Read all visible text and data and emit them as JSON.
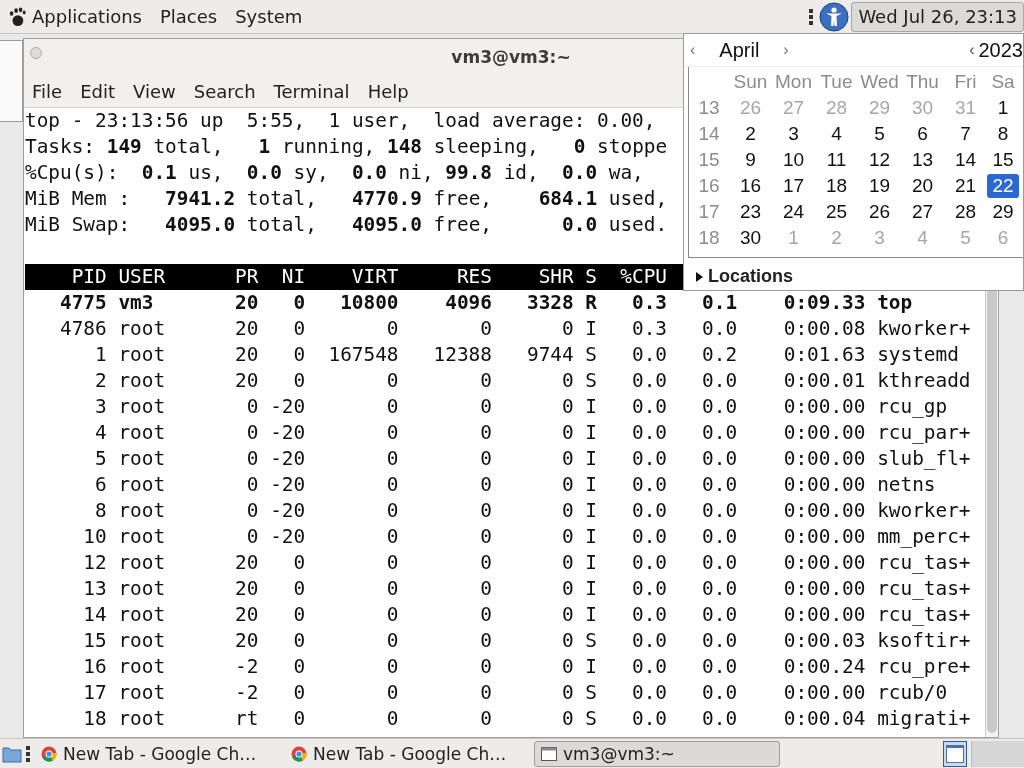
{
  "top_panel": {
    "menus": [
      "Applications",
      "Places",
      "System"
    ],
    "clock": "Wed Jul 26, 23:13"
  },
  "terminal": {
    "title": "vm3@vm3:~",
    "menu": [
      "File",
      "Edit",
      "View",
      "Search",
      "Terminal",
      "Help"
    ],
    "summary": [
      "top - 23:13:56 up  5:55,  1 user,  load average: 0.00,",
      "Tasks: **149** total,   **1** running, **148** sleeping,   **0** stoppe",
      "%Cpu(s):  **0.1** us,  **0.0** sy,  **0.0** ni, **99.8** id,  **0.0** wa,",
      "MiB Mem :   **7941.2** total,   **4770.9** free,    **684.1** used,",
      "MiB Swap:   **4095.0** total,   **4095.0** free,      **0.0** used."
    ],
    "columns": [
      "PID",
      "USER",
      "PR",
      "NI",
      "VIRT",
      "RES",
      "SHR",
      "S",
      "%CPU"
    ],
    "rows": [
      {
        "highlighted": true,
        "cells": [
          "4775",
          "vm3",
          "20",
          "0",
          "10800",
          "4096",
          "3328",
          "R",
          "0.3",
          "0.1",
          "0:09.33",
          "top"
        ]
      },
      {
        "highlighted": false,
        "cells": [
          "4786",
          "root",
          "20",
          "0",
          "0",
          "0",
          "0",
          "I",
          "0.3",
          "0.0",
          "0:00.08",
          "kworker+"
        ]
      },
      {
        "highlighted": false,
        "cells": [
          "1",
          "root",
          "20",
          "0",
          "167548",
          "12388",
          "9744",
          "S",
          "0.0",
          "0.2",
          "0:01.63",
          "systemd"
        ]
      },
      {
        "highlighted": false,
        "cells": [
          "2",
          "root",
          "20",
          "0",
          "0",
          "0",
          "0",
          "S",
          "0.0",
          "0.0",
          "0:00.01",
          "kthreadd"
        ]
      },
      {
        "highlighted": false,
        "cells": [
          "3",
          "root",
          "0",
          "-20",
          "0",
          "0",
          "0",
          "I",
          "0.0",
          "0.0",
          "0:00.00",
          "rcu_gp"
        ]
      },
      {
        "highlighted": false,
        "cells": [
          "4",
          "root",
          "0",
          "-20",
          "0",
          "0",
          "0",
          "I",
          "0.0",
          "0.0",
          "0:00.00",
          "rcu_par+"
        ]
      },
      {
        "highlighted": false,
        "cells": [
          "5",
          "root",
          "0",
          "-20",
          "0",
          "0",
          "0",
          "I",
          "0.0",
          "0.0",
          "0:00.00",
          "slub_fl+"
        ]
      },
      {
        "highlighted": false,
        "cells": [
          "6",
          "root",
          "0",
          "-20",
          "0",
          "0",
          "0",
          "I",
          "0.0",
          "0.0",
          "0:00.00",
          "netns"
        ]
      },
      {
        "highlighted": false,
        "cells": [
          "8",
          "root",
          "0",
          "-20",
          "0",
          "0",
          "0",
          "I",
          "0.0",
          "0.0",
          "0:00.00",
          "kworker+"
        ]
      },
      {
        "highlighted": false,
        "cells": [
          "10",
          "root",
          "0",
          "-20",
          "0",
          "0",
          "0",
          "I",
          "0.0",
          "0.0",
          "0:00.00",
          "mm_perc+"
        ]
      },
      {
        "highlighted": false,
        "cells": [
          "12",
          "root",
          "20",
          "0",
          "0",
          "0",
          "0",
          "I",
          "0.0",
          "0.0",
          "0:00.00",
          "rcu_tas+"
        ]
      },
      {
        "highlighted": false,
        "cells": [
          "13",
          "root",
          "20",
          "0",
          "0",
          "0",
          "0",
          "I",
          "0.0",
          "0.0",
          "0:00.00",
          "rcu_tas+"
        ]
      },
      {
        "highlighted": false,
        "cells": [
          "14",
          "root",
          "20",
          "0",
          "0",
          "0",
          "0",
          "I",
          "0.0",
          "0.0",
          "0:00.00",
          "rcu_tas+"
        ]
      },
      {
        "highlighted": false,
        "cells": [
          "15",
          "root",
          "20",
          "0",
          "0",
          "0",
          "0",
          "S",
          "0.0",
          "0.0",
          "0:00.03",
          "ksoftir+"
        ]
      },
      {
        "highlighted": false,
        "cells": [
          "16",
          "root",
          "-2",
          "0",
          "0",
          "0",
          "0",
          "I",
          "0.0",
          "0.0",
          "0:00.24",
          "rcu_pre+"
        ]
      },
      {
        "highlighted": false,
        "cells": [
          "17",
          "root",
          "-2",
          "0",
          "0",
          "0",
          "0",
          "S",
          "0.0",
          "0.0",
          "0:00.00",
          "rcub/0"
        ]
      },
      {
        "highlighted": false,
        "cells": [
          "18",
          "root",
          "rt",
          "0",
          "0",
          "0",
          "0",
          "S",
          "0.0",
          "0.0",
          "0:00.04",
          "migrati+"
        ]
      }
    ]
  },
  "calendar": {
    "prev_month": "‹",
    "month": "April",
    "next_month": "›",
    "prev_year": "‹",
    "year": "2023",
    "weekdays": [
      "Sun",
      "Mon",
      "Tue",
      "Wed",
      "Thu",
      "Fri",
      "Sa"
    ],
    "weeks": [
      {
        "number": "13",
        "days": [
          {
            "label": "26",
            "other_month": true,
            "selected": false
          },
          {
            "label": "27",
            "other_month": true,
            "selected": false
          },
          {
            "label": "28",
            "other_month": true,
            "selected": false
          },
          {
            "label": "29",
            "other_month": true,
            "selected": false
          },
          {
            "label": "30",
            "other_month": true,
            "selected": false
          },
          {
            "label": "31",
            "other_month": true,
            "selected": false
          },
          {
            "label": "1",
            "other_month": false,
            "selected": false
          }
        ]
      },
      {
        "number": "14",
        "days": [
          {
            "label": "2",
            "other_month": false,
            "selected": false
          },
          {
            "label": "3",
            "other_month": false,
            "selected": false
          },
          {
            "label": "4",
            "other_month": false,
            "selected": false
          },
          {
            "label": "5",
            "other_month": false,
            "selected": false
          },
          {
            "label": "6",
            "other_month": false,
            "selected": false
          },
          {
            "label": "7",
            "other_month": false,
            "selected": false
          },
          {
            "label": "8",
            "other_month": false,
            "selected": false
          }
        ]
      },
      {
        "number": "15",
        "days": [
          {
            "label": "9",
            "other_month": false,
            "selected": false
          },
          {
            "label": "10",
            "other_month": false,
            "selected": false
          },
          {
            "label": "11",
            "other_month": false,
            "selected": false
          },
          {
            "label": "12",
            "other_month": false,
            "selected": false
          },
          {
            "label": "13",
            "other_month": false,
            "selected": false
          },
          {
            "label": "14",
            "other_month": false,
            "selected": false
          },
          {
            "label": "15",
            "other_month": false,
            "selected": false
          }
        ]
      },
      {
        "number": "16",
        "days": [
          {
            "label": "16",
            "other_month": false,
            "selected": false
          },
          {
            "label": "17",
            "other_month": false,
            "selected": false
          },
          {
            "label": "18",
            "other_month": false,
            "selected": false
          },
          {
            "label": "19",
            "other_month": false,
            "selected": false
          },
          {
            "label": "20",
            "other_month": false,
            "selected": false
          },
          {
            "label": "21",
            "other_month": false,
            "selected": false
          },
          {
            "label": "22",
            "other_month": false,
            "selected": true
          }
        ]
      },
      {
        "number": "17",
        "days": [
          {
            "label": "23",
            "other_month": false,
            "selected": false
          },
          {
            "label": "24",
            "other_month": false,
            "selected": false
          },
          {
            "label": "25",
            "other_month": false,
            "selected": false
          },
          {
            "label": "26",
            "other_month": false,
            "selected": false
          },
          {
            "label": "27",
            "other_month": false,
            "selected": false
          },
          {
            "label": "28",
            "other_month": false,
            "selected": false
          },
          {
            "label": "29",
            "other_month": false,
            "selected": false
          }
        ]
      },
      {
        "number": "18",
        "days": [
          {
            "label": "30",
            "other_month": false,
            "selected": false
          },
          {
            "label": "1",
            "other_month": true,
            "selected": false
          },
          {
            "label": "2",
            "other_month": true,
            "selected": false
          },
          {
            "label": "3",
            "other_month": true,
            "selected": false
          },
          {
            "label": "4",
            "other_month": true,
            "selected": false
          },
          {
            "label": "5",
            "other_month": true,
            "selected": false
          },
          {
            "label": "6",
            "other_month": true,
            "selected": false
          }
        ]
      }
    ],
    "locations": "Locations",
    "locations_expanded": false
  },
  "taskbar": {
    "items": [
      {
        "label": "New Tab - Google Ch…",
        "kind": "browser",
        "active": false
      },
      {
        "label": "New Tab - Google Ch…",
        "kind": "browser",
        "active": false
      },
      {
        "label": "vm3@vm3:~",
        "kind": "terminal",
        "active": true
      }
    ]
  }
}
